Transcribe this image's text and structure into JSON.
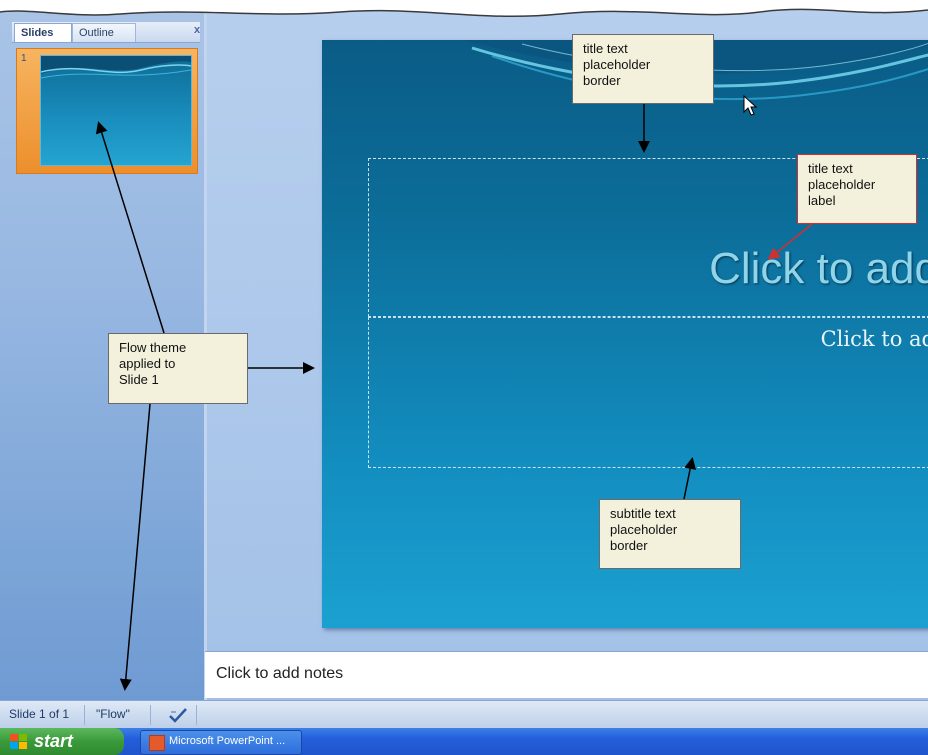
{
  "pane": {
    "tabs": {
      "slides": "Slides",
      "outline": "Outline"
    },
    "close_icon": "x",
    "thumb_number": "1"
  },
  "slide": {
    "title_placeholder": "Click to add",
    "subtitle_placeholder": "Click to ad"
  },
  "notes": {
    "placeholder": "Click to add notes"
  },
  "statusbar": {
    "slide_counter": "Slide 1 of 1",
    "theme_name": "\"Flow\"",
    "spell_icon": "proofing-check-icon"
  },
  "taskbar": {
    "start_label": "start",
    "task_label": "Microsoft PowerPoint ..."
  },
  "callouts": {
    "title_border": "title text\nplaceholder\nborder",
    "title_label": "title text\nplaceholder\nlabel",
    "flow_theme": "Flow theme\napplied to\nSlide 1",
    "subtitle_border": "subtitle text\nplaceholder\nborder"
  },
  "colors": {
    "slide_dark": "#0a5c86",
    "slide_light": "#1ba1d1",
    "callout_bg": "#f3f1dc",
    "callout_red_border": "#d22f2f",
    "thumb_selected": "#ec8f2c"
  }
}
